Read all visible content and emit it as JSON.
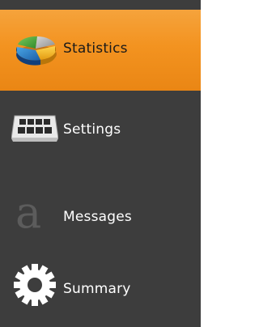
{
  "sidebar": {
    "items": [
      {
        "label": "Statistics",
        "icon": "pie-chart-icon",
        "active": true
      },
      {
        "label": "Settings",
        "icon": "keyboard-icon",
        "active": false
      },
      {
        "label": "Messages",
        "icon": "letter-a-icon",
        "active": false
      },
      {
        "label": "Summary",
        "icon": "gear-icon",
        "active": false
      }
    ]
  },
  "colors": {
    "sidebar_background": "#3d3d3d",
    "active_item": "#f39320",
    "active_text": "#1a1a1a",
    "item_text": "#ffffff"
  }
}
